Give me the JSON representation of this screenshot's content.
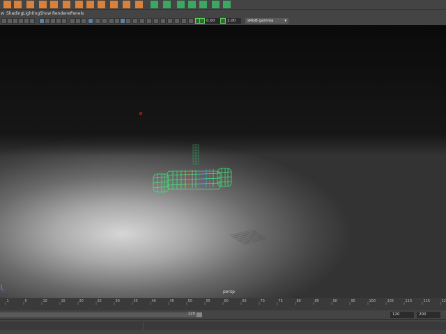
{
  "menu": [
    "w",
    "Shading",
    "Lighting",
    "Show",
    "Renderer",
    "Panels"
  ],
  "toolbar": {
    "exposure_value": "0.00",
    "gamma_value": "1.00",
    "color_space": "sRGB gamma"
  },
  "viewport": {
    "camera": "persp"
  },
  "timeline": {
    "tick_labels": [
      "1",
      "5",
      "10",
      "15",
      "20",
      "25",
      "30",
      "35",
      "40",
      "45",
      "50",
      "55",
      "60",
      "65",
      "70",
      "75",
      "80",
      "85",
      "90",
      "95",
      "100",
      "105",
      "110",
      "115",
      "120"
    ],
    "range_slider_value": "120",
    "end_time": "120",
    "anim_end": "200"
  },
  "colors": {
    "wireframe": "#3ee87a",
    "background": "#444444",
    "accent": "#5d7fa8"
  },
  "icons": [
    "polygon-cube-icon",
    "polygon-sphere-icon",
    "select-tool-icon",
    "move-tool-icon",
    "snap-grid-icon",
    "render-icon",
    "wireframe-toggle-icon"
  ]
}
